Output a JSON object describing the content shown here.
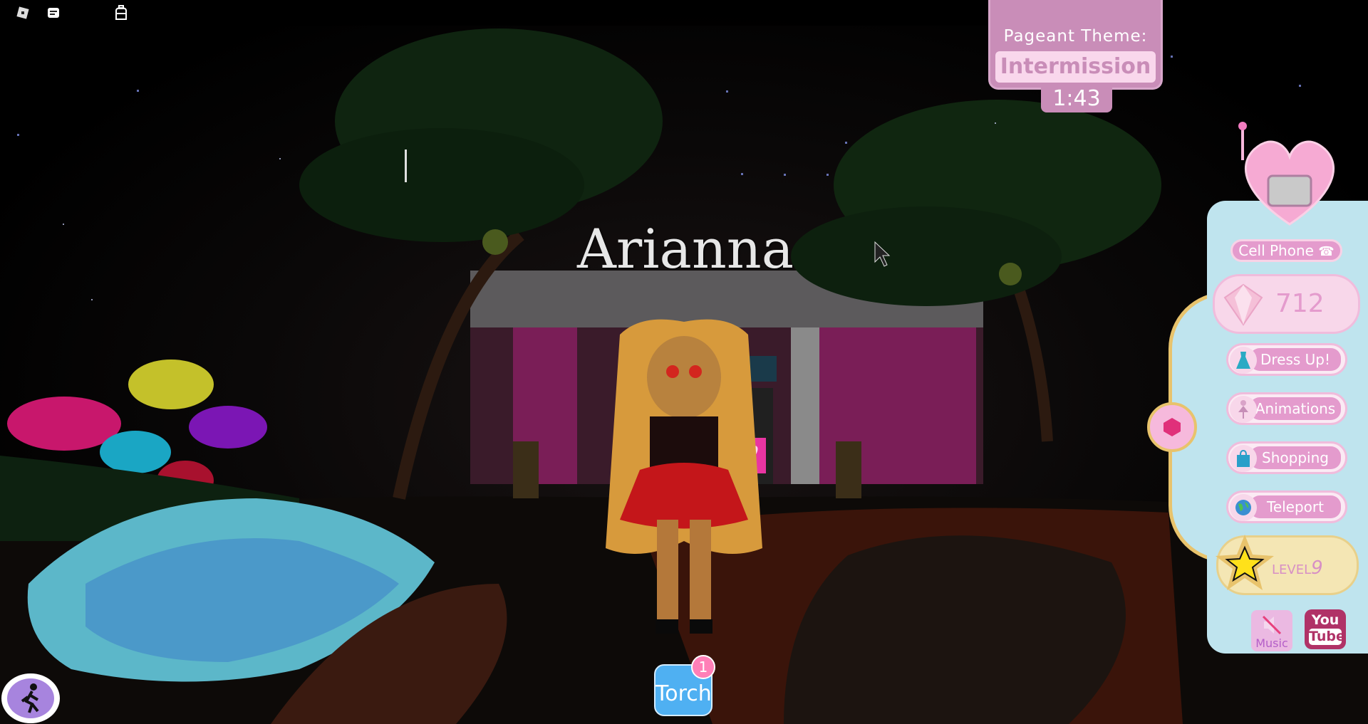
{
  "topbar": {
    "icons": [
      "roblox-logo-icon",
      "chat-icon",
      "backpack-icon"
    ]
  },
  "pageant": {
    "label": "Pageant Theme:",
    "theme": "Intermission",
    "timer": "1:43"
  },
  "player": {
    "name": "Arianna"
  },
  "side_panel": {
    "phone_label": "Cell Phone",
    "gems": "712",
    "menu": [
      {
        "label": "Dress Up!",
        "icon": "dress-icon"
      },
      {
        "label": "Animations",
        "icon": "ballerina-icon"
      },
      {
        "label": "Shopping",
        "icon": "shopping-bag-icon"
      },
      {
        "label": "Teleport",
        "icon": "globe-icon"
      }
    ],
    "level_label": "LEVEL",
    "level_value": "9",
    "music_label": "Music",
    "youtube_label_top": "You",
    "youtube_label_bottom": "Tube"
  },
  "hotbar": {
    "torch_label": "Torch",
    "torch_badge": "1"
  },
  "colors": {
    "accent_pink": "#e49bcd",
    "panel_blue": "#bfe4ee",
    "torch_blue": "#4fb0f2",
    "gold": "#e8c36c"
  }
}
